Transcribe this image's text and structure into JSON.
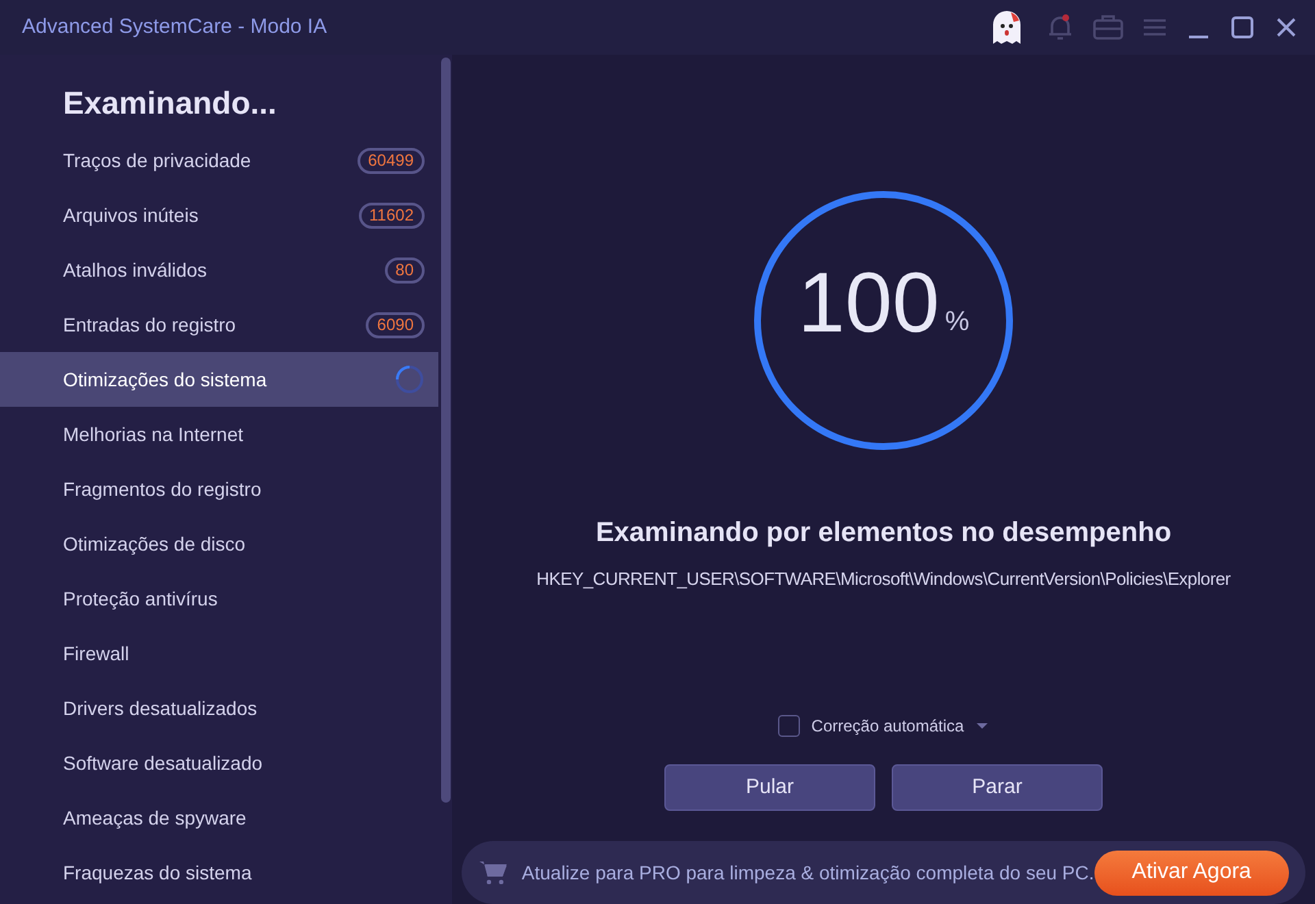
{
  "window": {
    "title": "Advanced SystemCare - Modo IA"
  },
  "sidebar": {
    "heading": "Examinando...",
    "items": [
      {
        "label": "Traços de privacidade",
        "kind": "count",
        "count": "60499",
        "selected": false
      },
      {
        "label": "Arquivos inúteis",
        "kind": "count",
        "count": "11602",
        "selected": false
      },
      {
        "label": "Atalhos inválidos",
        "kind": "count",
        "count": "80",
        "selected": false
      },
      {
        "label": "Entradas do registro",
        "kind": "count",
        "count": "6090",
        "selected": false
      },
      {
        "label": "Otimizações do sistema",
        "kind": "spinner",
        "selected": true
      },
      {
        "label": "Melhorias na Internet",
        "kind": "plain",
        "selected": false
      },
      {
        "label": "Fragmentos do registro",
        "kind": "plain",
        "selected": false
      },
      {
        "label": "Otimizações de disco",
        "kind": "plain",
        "selected": false
      },
      {
        "label": "Proteção antivírus",
        "kind": "plain",
        "selected": false
      },
      {
        "label": "Firewall",
        "kind": "plain",
        "selected": false
      },
      {
        "label": "Drivers desatualizados",
        "kind": "plain",
        "selected": false
      },
      {
        "label": "Software desatualizado",
        "kind": "plain",
        "selected": false
      },
      {
        "label": "Ameaças de spyware",
        "kind": "plain",
        "selected": false
      },
      {
        "label": "Fraquezas do sistema",
        "kind": "plain",
        "selected": false
      }
    ]
  },
  "progress": {
    "value": "100",
    "unit": "%",
    "level": 1
  },
  "status": {
    "title": "Examinando por elementos no desempenho",
    "path": "HKEY_CURRENT_USER\\SOFTWARE\\Microsoft\\Windows\\CurrentVersion\\Policies\\Explorer"
  },
  "auto_fix": {
    "label": "Correção automática",
    "checked": false
  },
  "buttons": [
    "Pular",
    "Parar"
  ],
  "promo": {
    "text": "Atualize para PRO para limpeza & otimização completa do seu PC.",
    "button": "Ativar Agora"
  }
}
